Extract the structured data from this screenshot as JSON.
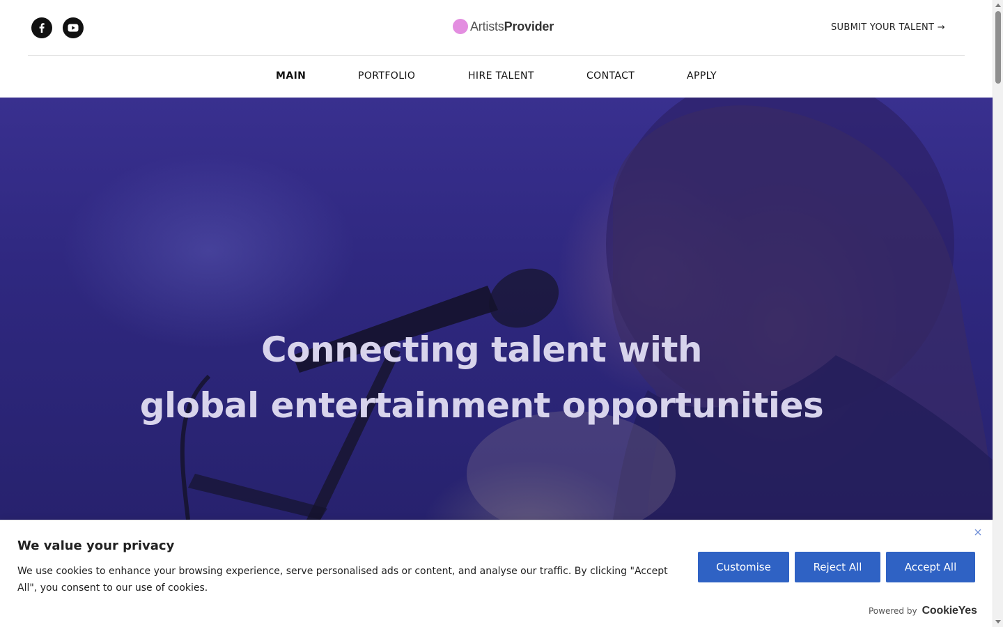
{
  "header": {
    "social": [
      {
        "name": "facebook",
        "icon": "facebook-icon"
      },
      {
        "name": "youtube",
        "icon": "youtube-icon"
      }
    ],
    "logo": {
      "part1": "Artists",
      "part2": "Provider",
      "dot_color": "#e38ee0"
    },
    "submit_label": "SUBMIT YOUR TALENT →"
  },
  "nav": {
    "items": [
      {
        "label": "MAIN",
        "active": true
      },
      {
        "label": "PORTFOLIO",
        "active": false
      },
      {
        "label": "HIRE TALENT",
        "active": false
      },
      {
        "label": "CONTACT",
        "active": false
      },
      {
        "label": "APPLY",
        "active": false
      }
    ]
  },
  "hero": {
    "line1": "Connecting talent with",
    "line2": "global entertainment opportunities",
    "overlay_color": "#2f2880"
  },
  "cookie": {
    "title": "We value your privacy",
    "text": "We use cookies to enhance your browsing experience, serve personalised ads or content, and analyse our traffic. By clicking \"Accept All\", you consent to our use of cookies.",
    "buttons": {
      "customise": "Customise",
      "reject": "Reject All",
      "accept": "Accept All"
    },
    "powered_by": "Powered by",
    "brand": "CookieYes",
    "button_color": "#2f62c4"
  }
}
